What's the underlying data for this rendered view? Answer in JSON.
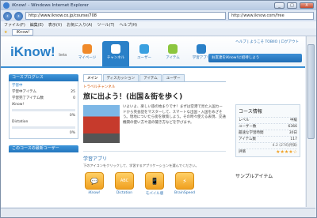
{
  "window": {
    "title": "iKnow! - Windows Internet Explorer",
    "buttons": {
      "minimize": "_",
      "maximize": "□",
      "close": "X"
    }
  },
  "browser": {
    "url": "http://www.iknow.co.jp/course/708",
    "search": "http://www.iknow.com/free",
    "menu": [
      "ファイル(F)",
      "編集(E)",
      "表示(V)",
      "お気に入り(A)",
      "ツール(T)",
      "ヘルプ(H)"
    ],
    "tab": "iKnow!"
  },
  "site": {
    "logo": "iKnow!",
    "logo_beta": "beta",
    "userlinks": "ヘルプ | ようこそ TOBIIO | ログアウト",
    "promo": "お友達をiKnow!に招待しよう",
    "nav": [
      {
        "label": "マイページ",
        "color": "#f08a2a"
      },
      {
        "label": "チャンネル",
        "color": "#ffffff"
      },
      {
        "label": "ユーザー",
        "color": "#3aa0e0"
      },
      {
        "label": "アイテム",
        "color": "#8cc63f"
      },
      {
        "label": "学習アプリ",
        "color": "#2a80c8"
      }
    ]
  },
  "left": {
    "progress_title": "コースプログレス",
    "progress_sub": "学習中",
    "rows": [
      {
        "label": "学習中アイテム",
        "value": "25"
      },
      {
        "label": "学習完了アイテム数",
        "value": "0"
      }
    ],
    "apps": [
      {
        "label": "iKnow!",
        "pct": "0%",
        "fill": 0
      },
      {
        "label": "Dictation",
        "pct": "0%",
        "fill": 0
      }
    ],
    "users_title": "このコースの最新ユーザー"
  },
  "main": {
    "tabs": [
      "メイン",
      "ディスカッション",
      "アイテム",
      "ユーザー"
    ],
    "crumb": "トラベルチャンネル",
    "title": "旅に出よう！(出国＆街を歩く)",
    "desc": "いよいよ、楽しい旅の始まりです！まずは空港で見た入国カードから英会話をマスターして、スマートな出国・入国をめざそう。現地についたら街を散策しよう。その時々使える表現、交通機関の使い方や道の聞き方などを学びます。",
    "app_section_title": "学習アプリ",
    "app_section_desc": "下のアイコンをクリックして、学習するアプリケーションを選んでください。",
    "apps": [
      {
        "label": "iKnow!",
        "glyph": "💬"
      },
      {
        "label": "Dictation",
        "glyph": "ABC"
      },
      {
        "label": "モバイル版",
        "glyph": "📱"
      },
      {
        "label": "BrainSpeed",
        "glyph": "⚡"
      }
    ]
  },
  "right": {
    "info_title": "コース情報",
    "rows": [
      {
        "label": "レベル",
        "value": "中級"
      },
      {
        "label": "ユーザー数",
        "value": "6366"
      },
      {
        "label": "最速な学習時間",
        "value": "30日"
      },
      {
        "label": "アイテム数",
        "value": "117"
      }
    ],
    "rating_score": "4.2 (27の評価)",
    "rating_label": "評価",
    "stars": "★★★★☆",
    "sample_title": "サンプルアイテム"
  }
}
